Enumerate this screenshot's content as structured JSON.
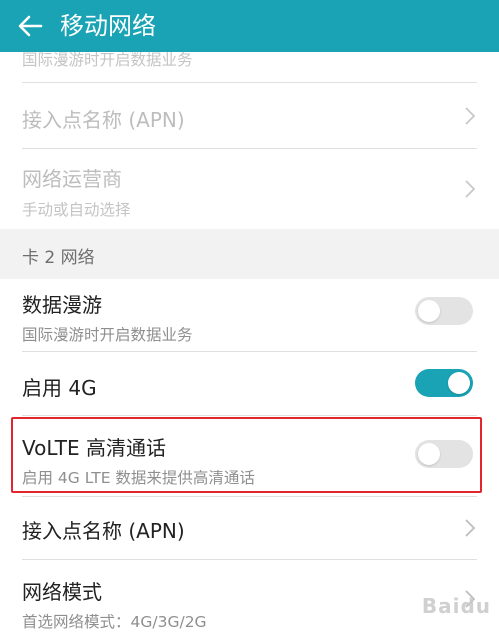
{
  "header": {
    "title": "移动网络"
  },
  "top_partial": {
    "secondary": "国际漫游时开启数据业务"
  },
  "card1": {
    "apn": {
      "label": "接入点名称 (APN)"
    },
    "operator": {
      "label": "网络运营商",
      "secondary": "手动或自动选择"
    }
  },
  "section": {
    "label": "卡 2 网络"
  },
  "card2": {
    "roaming": {
      "label": "数据漫游",
      "secondary": "国际漫游时开启数据业务",
      "enabled": false
    },
    "enable4g": {
      "label": "启用 4G",
      "enabled": true
    },
    "volte": {
      "label": "VoLTE 高清通话",
      "secondary": "启用 4G LTE 数据来提供高清通话",
      "enabled": false
    },
    "apn": {
      "label": "接入点名称 (APN)"
    },
    "network_mode": {
      "label": "网络模式",
      "secondary": "首选网络模式：4G/3G/2G"
    }
  },
  "watermark": {
    "text": "Baidu"
  },
  "colors": {
    "accent": "#1aa3b5",
    "highlight": "#e2262f",
    "switch_off": "#e3e3e3"
  }
}
